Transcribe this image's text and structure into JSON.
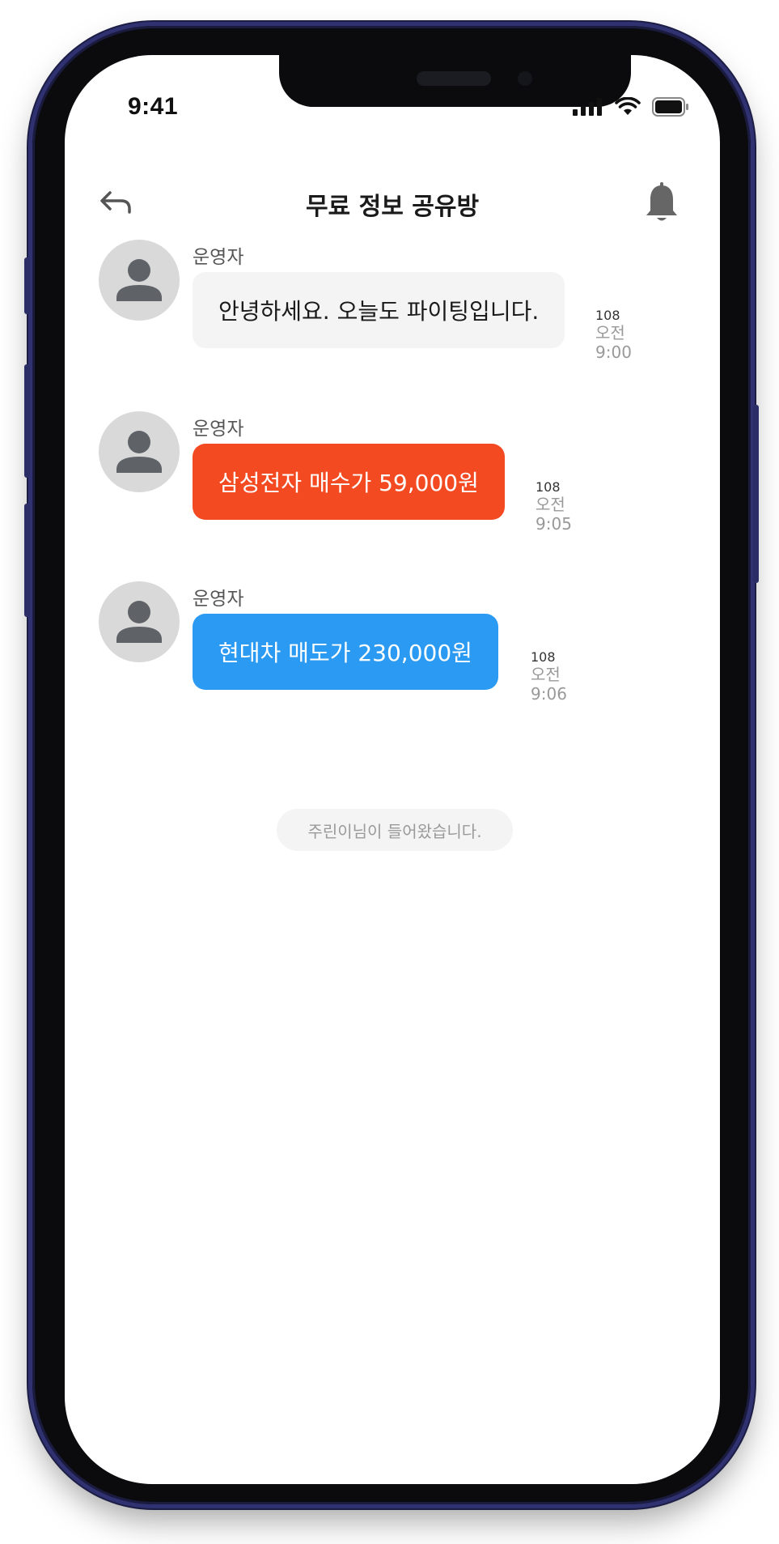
{
  "status_bar": {
    "time": "9:41"
  },
  "header": {
    "title": "무료 정보 공유방",
    "back_icon": "back-arrow-icon",
    "notification_icon": "bell-icon"
  },
  "messages": [
    {
      "sender": "운영자",
      "text": "안녕하세요. 오늘도 파이팅입니다.",
      "count": "108",
      "time": "오전 9:00",
      "bubble_color": "#f4f4f4"
    },
    {
      "sender": "운영자",
      "text": "삼성전자 매수가 59,000원",
      "count": "108",
      "time": "오전 9:05",
      "bubble_color": "#f44a22"
    },
    {
      "sender": "운영자",
      "text": "현대차 매도가 230,000원",
      "count": "108",
      "time": "오전 9:06",
      "bubble_color": "#2b9af2"
    }
  ],
  "system_notice": "주린이님이 들어왔습니다."
}
